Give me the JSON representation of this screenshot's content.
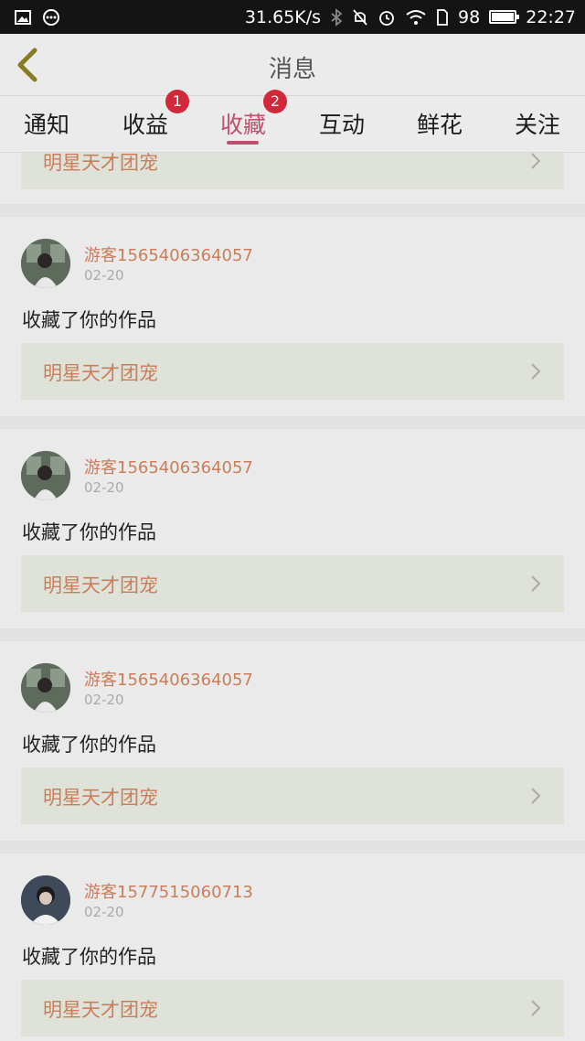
{
  "status_bar": {
    "speed": "31.65K/s",
    "battery": "98",
    "time": "22:27",
    "left_icons": [
      "image-icon",
      "chat-icon"
    ],
    "right_icons": [
      "bluetooth-icon",
      "mute-icon",
      "alarm-icon",
      "wifi-icon",
      "sim-icon"
    ]
  },
  "nav": {
    "title": "消息",
    "back_icon": "chevron-left-icon"
  },
  "tabs": [
    {
      "label": "通知",
      "badge": ""
    },
    {
      "label": "收益",
      "badge": "1"
    },
    {
      "label": "收藏",
      "badge": "2",
      "active": true
    },
    {
      "label": "互动",
      "badge": ""
    },
    {
      "label": "鲜花",
      "badge": ""
    },
    {
      "label": "关注",
      "badge": ""
    }
  ],
  "partial_card": {
    "work_title": "明星天才团宠"
  },
  "items": [
    {
      "user": "游客1565406364057",
      "date": "02-20",
      "action": "收藏了你的作品",
      "work_title": "明星天才团宠"
    },
    {
      "user": "游客1565406364057",
      "date": "02-20",
      "action": "收藏了你的作品",
      "work_title": "明星天才团宠"
    },
    {
      "user": "游客1565406364057",
      "date": "02-20",
      "action": "收藏了你的作品",
      "work_title": "明星天才团宠"
    },
    {
      "user": "游客1577515060713",
      "date": "02-20",
      "action": "收藏了你的作品",
      "work_title": "明星天才团宠"
    }
  ],
  "colors": {
    "accent": "#c0506f",
    "badge": "#d3273a",
    "link": "#c97d5b"
  }
}
